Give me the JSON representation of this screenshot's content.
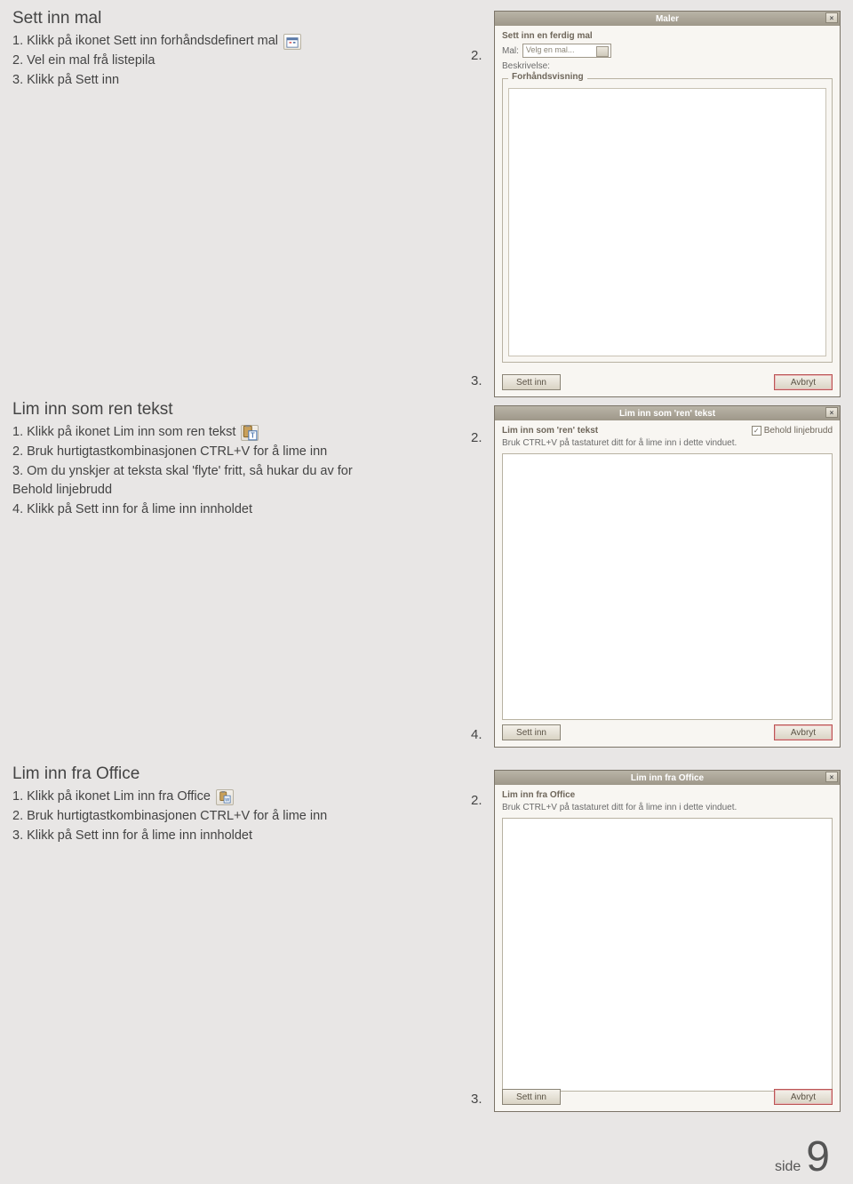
{
  "section1": {
    "heading": "Sett inn mal",
    "steps": [
      "1. Klikk på ikonet Sett inn forhåndsdefinert mal",
      "2. Vel ein mal frå listepila",
      "3. Klikk på Sett inn"
    ]
  },
  "section2": {
    "heading": "Lim inn som ren tekst",
    "steps": [
      "1. Klikk på ikonet Lim inn som ren tekst",
      "2. Bruk hurtigtastkombinasjonen CTRL+V for å lime inn",
      "3. Om du ynskjer at teksta skal 'flyte' fritt, så hukar du av for Behold linjebrudd",
      "4. Klikk på Sett inn for å lime inn innholdet"
    ]
  },
  "section3": {
    "heading": "Lim inn fra Office",
    "steps": [
      "1. Klikk på ikonet Lim inn fra Office",
      "2. Bruk hurtigtastkombinasjonen CTRL+V for å lime inn",
      "3. Klikk på Sett inn for å lime inn innholdet"
    ]
  },
  "annotations": {
    "n2": "2.",
    "n3": "3.",
    "n4": "4."
  },
  "dialog1": {
    "title": "Maler",
    "subtitle": "Sett inn en ferdig mal",
    "mal_label": "Mal:",
    "mal_value": "Velg en mal...",
    "beskrivelse": "Beskrivelse:",
    "preview_legend": "Forhåndsvisning",
    "ok": "Sett inn",
    "cancel": "Avbryt"
  },
  "dialog2": {
    "title": "Lim inn som 'ren' tekst",
    "subtitle": "Lim inn som 'ren' tekst",
    "hint": "Bruk CTRL+V på tastaturet ditt for å lime inn i dette vinduet.",
    "checkbox": "Behold linjebrudd",
    "ok": "Sett inn",
    "cancel": "Avbryt"
  },
  "dialog3": {
    "title": "Lim inn fra Office",
    "subtitle": "Lim inn fra Office",
    "hint": "Bruk CTRL+V på tastaturet ditt for å lime inn i dette vinduet.",
    "ok": "Sett inn",
    "cancel": "Avbryt"
  },
  "page_label": "side",
  "page_number": "9"
}
